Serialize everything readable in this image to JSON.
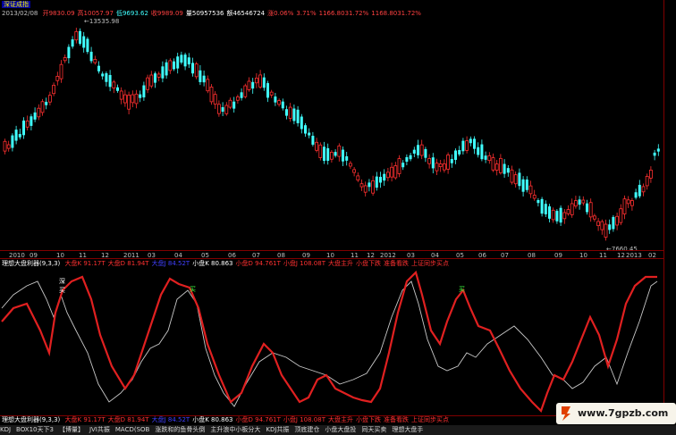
{
  "header": {
    "title": "深证成指",
    "date": "2013/02/08",
    "fields": [
      {
        "label": "开",
        "value": "9830.09",
        "color": "#ff4040"
      },
      {
        "label": "高",
        "value": "10057.97",
        "color": "#ff4040"
      },
      {
        "label": "低",
        "value": "9693.62",
        "color": "#40ffff"
      },
      {
        "label": "收",
        "value": "9989.09",
        "color": "#ff4040"
      },
      {
        "label": "量",
        "value": "50957536",
        "color": "#ffffff"
      },
      {
        "label": "额",
        "value": "46546724",
        "color": "#ffffff"
      },
      {
        "label": "涨",
        "value": "0.06%",
        "color": "#ff4040"
      },
      {
        "label": "",
        "value": "3.71%",
        "color": "#ff4040"
      },
      {
        "label": "",
        "value": "1166.8031.72%",
        "color": "#ff4040"
      },
      {
        "label": "",
        "value": "1168.8031.72%",
        "color": "#ff4040"
      }
    ],
    "high_marker": "13535.98",
    "low_marker": "7660.45"
  },
  "x_axis_months": [
    "2010",
    "09",
    "10",
    "11",
    "12",
    "2011",
    "03",
    "04",
    "05",
    "06",
    "07",
    "08",
    "09",
    "10",
    "11",
    "12",
    "2012",
    "03",
    "04",
    "05",
    "06",
    "07",
    "08",
    "09",
    "10",
    "11",
    "12",
    "2013",
    "02"
  ],
  "indicator_header": {
    "name": "理想大盘利器(9,3,3)",
    "items": [
      {
        "text": "大盘K 91.17T",
        "color": "#ff3030"
      },
      {
        "text": "大盘D 81.94T",
        "color": "#ff3030"
      },
      {
        "text": "大盘J 84.52T",
        "color": "#4040ff"
      },
      {
        "text": "小盘K 80.863",
        "color": "#ffffff"
      },
      {
        "text": "小盘D 94.761T",
        "color": "#ff3030"
      },
      {
        "text": "小盘J 108.08T",
        "color": "#ff3030"
      },
      {
        "text": "大盘主升",
        "color": "#ff3030"
      },
      {
        "text": "小盘下跌",
        "color": "#ff3030"
      },
      {
        "text": "准备看跌",
        "color": "#ff3030"
      },
      {
        "text": "上证同步买点",
        "color": "#ff3030"
      }
    ]
  },
  "bottom_indicator_header": {
    "name": "理想大盘利器(9,3,3)",
    "items": [
      {
        "text": "大盘K 91.17T",
        "color": "#ff3030"
      },
      {
        "text": "大盘D 81.94T",
        "color": "#ff3030"
      },
      {
        "text": "大盘J 84.52T",
        "color": "#4040ff"
      },
      {
        "text": "小盘K 80.863",
        "color": "#ffffff"
      },
      {
        "text": "小盘D 94.761T",
        "color": "#ff3030"
      },
      {
        "text": "小盘J 108.08T",
        "color": "#ff3030"
      },
      {
        "text": "大盘主升",
        "color": "#ff3030"
      },
      {
        "text": "小盘下跌",
        "color": "#ff3030"
      },
      {
        "text": "准备看跌",
        "color": "#ff3030"
      },
      {
        "text": "上证同步买点",
        "color": "#ff3030"
      }
    ]
  },
  "signal_labels": [
    "深",
    "买",
    "买",
    "买"
  ],
  "status_bar": [
    "KDJ",
    "BOX10天下3",
    "【博量】",
    "JVI共振",
    "MACD(SOB",
    "涨跌和的鱼骨头倒",
    "主升浪中小板分大",
    "KDJ共振",
    "顶底建仓",
    "小盘大盘投",
    "同天买卖",
    "理想大盘手"
  ],
  "watermark": "www.7gpzb.com",
  "colors": {
    "up": "#ff3030",
    "down": "#40ffff",
    "bg": "#000000",
    "grid": "#800000"
  }
}
